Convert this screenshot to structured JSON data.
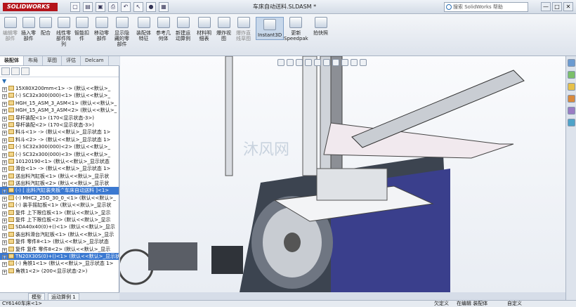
{
  "window": {
    "app_logo": "SOLIDWORKS",
    "document_title": "车床自动送料.SLDASM *",
    "help_search_placeholder": "搜索 SolidWorks 帮助",
    "minimize": "—",
    "restore": "□",
    "close": "✕"
  },
  "toolbar": {
    "items": [
      {
        "label": "编辑零\n部件",
        "enabled": false
      },
      {
        "label": "插入零\n部件",
        "enabled": true
      },
      {
        "label": "配合",
        "enabled": true
      },
      {
        "label": "线性零\n部件阵\n列",
        "enabled": true
      },
      {
        "label": "智能扣\n件",
        "enabled": true
      },
      {
        "label": "移动零\n部件",
        "enabled": true
      },
      {
        "label": "显示隐\n藏的零\n部件",
        "enabled": true
      },
      {
        "label": "装配体\n特征",
        "enabled": true
      },
      {
        "label": "参考几\n何体",
        "enabled": true
      },
      {
        "label": "新建运\n动算例",
        "enabled": true
      },
      {
        "label": "材料明\n细表",
        "enabled": true
      },
      {
        "label": "爆炸视\n图",
        "enabled": true
      },
      {
        "label": "爆炸直\n线草图",
        "enabled": false
      },
      {
        "label": "Instant3D",
        "enabled": true,
        "selected": true
      },
      {
        "label": "更新\nSpeedpak",
        "enabled": true
      },
      {
        "label": "拍快照",
        "enabled": true
      }
    ]
  },
  "panel_tabs": [
    "装配体",
    "布局",
    "草图",
    "评估",
    "Delcam"
  ],
  "feature_tree": [
    {
      "label": "15X80X200mm<1> -> (默认<<默认>_",
      "hl": false
    },
    {
      "label": "(-) SC32x300(000)<1> (默认<<默认>_",
      "hl": false
    },
    {
      "label": "HGH_15_ASM_3_ASM<1> (默认<<默认>_",
      "hl": false
    },
    {
      "label": "HGH_15_ASM_3_ASM<2> (默认<<默认>_",
      "hl": false
    },
    {
      "label": "导杆装配<1> (170<显示状态-3>)",
      "hl": false
    },
    {
      "label": "导杆装配<2> (170<显示状态-3>)",
      "hl": false
    },
    {
      "label": "料斗<1> -> (默认<<默认>_显示状态 1>",
      "hl": false
    },
    {
      "label": "料斗<2> -> (默认<<默认>_显示状态 1>",
      "hl": false
    },
    {
      "label": "(-) SC32x300(000)<2> (默认<<默认>_",
      "hl": false
    },
    {
      "label": "(-) SC32x300(000)<3> (默认<<默认>_",
      "hl": false
    },
    {
      "label": "10120190<1> (默认<<默认>_显示状态",
      "hl": false
    },
    {
      "label": "滑台<1> -> (默认<<默认>_显示状态 1>",
      "hl": false
    },
    {
      "label": "送出料汽缸板<1> (默认<<默认>_显示状",
      "hl": false
    },
    {
      "label": "送出料汽缸板<2> (默认<<默认>_显示状",
      "hl": false
    },
    {
      "label": "(-) [ 出料汽缸装夹板^车床自动送料 ]<1>",
      "hl": true
    },
    {
      "label": "(-) MHC2_25D_30_0_<1> (默认<<默认>_",
      "hl": false
    },
    {
      "label": "(-) 装手摇缸板<1> (默认<<默认>_显示状",
      "hl": false
    },
    {
      "label": "复件 上下限位板<1> (默认<<默认>_显示",
      "hl": false
    },
    {
      "label": "复件 上下限位板<2> (默认<<默认>_显示",
      "hl": false
    },
    {
      "label": "SDA40x40(0)+()<1> (默认<<默认>_显示",
      "hl": false
    },
    {
      "label": "装出料滑台汽缸板<1> (默认<<默认>_显示",
      "hl": false
    },
    {
      "label": "复件 零件8<1> (默认<<默认>_显示状态",
      "hl": false
    },
    {
      "label": "复件 复件 零件8<2> (默认<<默认>_显示",
      "hl": false
    },
    {
      "label": "TN20X30S(0)+()<1> (默认<<默认>_显示状",
      "hl": true
    },
    {
      "label": "(-) 角铁1<1> (默认<<默认>_显示状态 1>",
      "hl": false
    },
    {
      "label": "角铁1<2> (200<显示状态-2>)",
      "hl": false
    }
  ],
  "bottom_tabs": {
    "model": "模型",
    "motion": "运动算例 1"
  },
  "status": {
    "left": "CY6140车床<1>",
    "under_defined": "欠定义",
    "editing": "在编辑 装配体",
    "custom": "自定义"
  }
}
